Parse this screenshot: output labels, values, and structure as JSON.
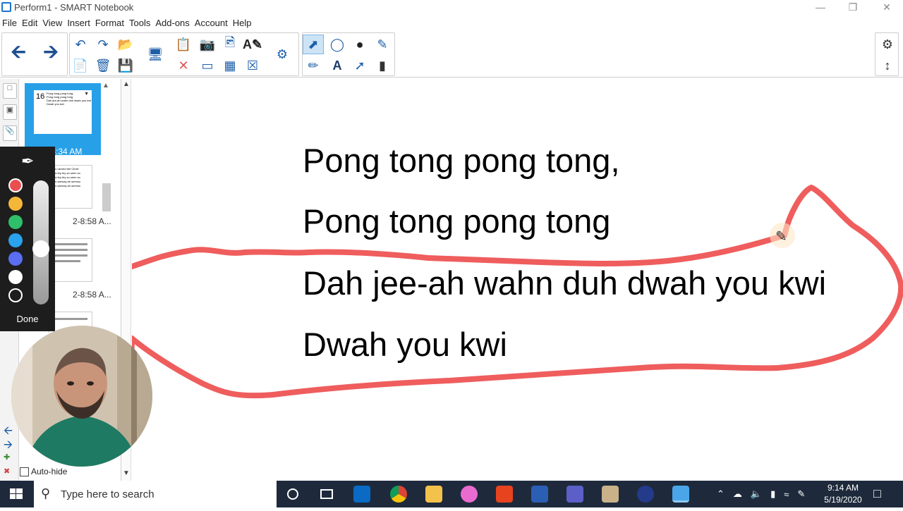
{
  "window": {
    "title": "Perform1 - SMART Notebook"
  },
  "menu": [
    "File",
    "Edit",
    "View",
    "Insert",
    "Format",
    "Tools",
    "Add-ons",
    "Account",
    "Help"
  ],
  "page_sorter": {
    "selected": {
      "page_number": "16",
      "thumb_lines": [
        "Pong tong pong tong,",
        "Pong tong pong tong",
        "Dah jee-ah wahn duh dwah you kwi",
        "Dwah you kwi"
      ],
      "caption": "1-8:34 AM"
    },
    "items": [
      {
        "caption": "2-8:58 A..."
      },
      {
        "caption": "2-8:58 A..."
      }
    ],
    "thumb2_lines": [
      "Tos ushred the Circle",
      "nos fey fey so seen so",
      "nos fey fey so seen so",
      "sos sarmay ah seenso",
      "sos sarmay ah seenso"
    ]
  },
  "pen_panel": {
    "colors": [
      "#ea4f4f",
      "#f5b73a",
      "#2fbf6b",
      "#2aa2ee",
      "#5b6df0",
      "#ffffff",
      "#1d1d1d"
    ],
    "done_label": "Done"
  },
  "autohide_label": "Auto-hide",
  "lyrics": [
    "Pong tong pong tong,",
    "Pong tong pong tong",
    "Dah jee-ah wahn duh dwah you kwi",
    "Dwah you kwi"
  ],
  "annotation_color": "#ef5d5d",
  "taskbar": {
    "search_placeholder": "Type here to search",
    "time": "9:14 AM",
    "date": "5/19/2020"
  }
}
